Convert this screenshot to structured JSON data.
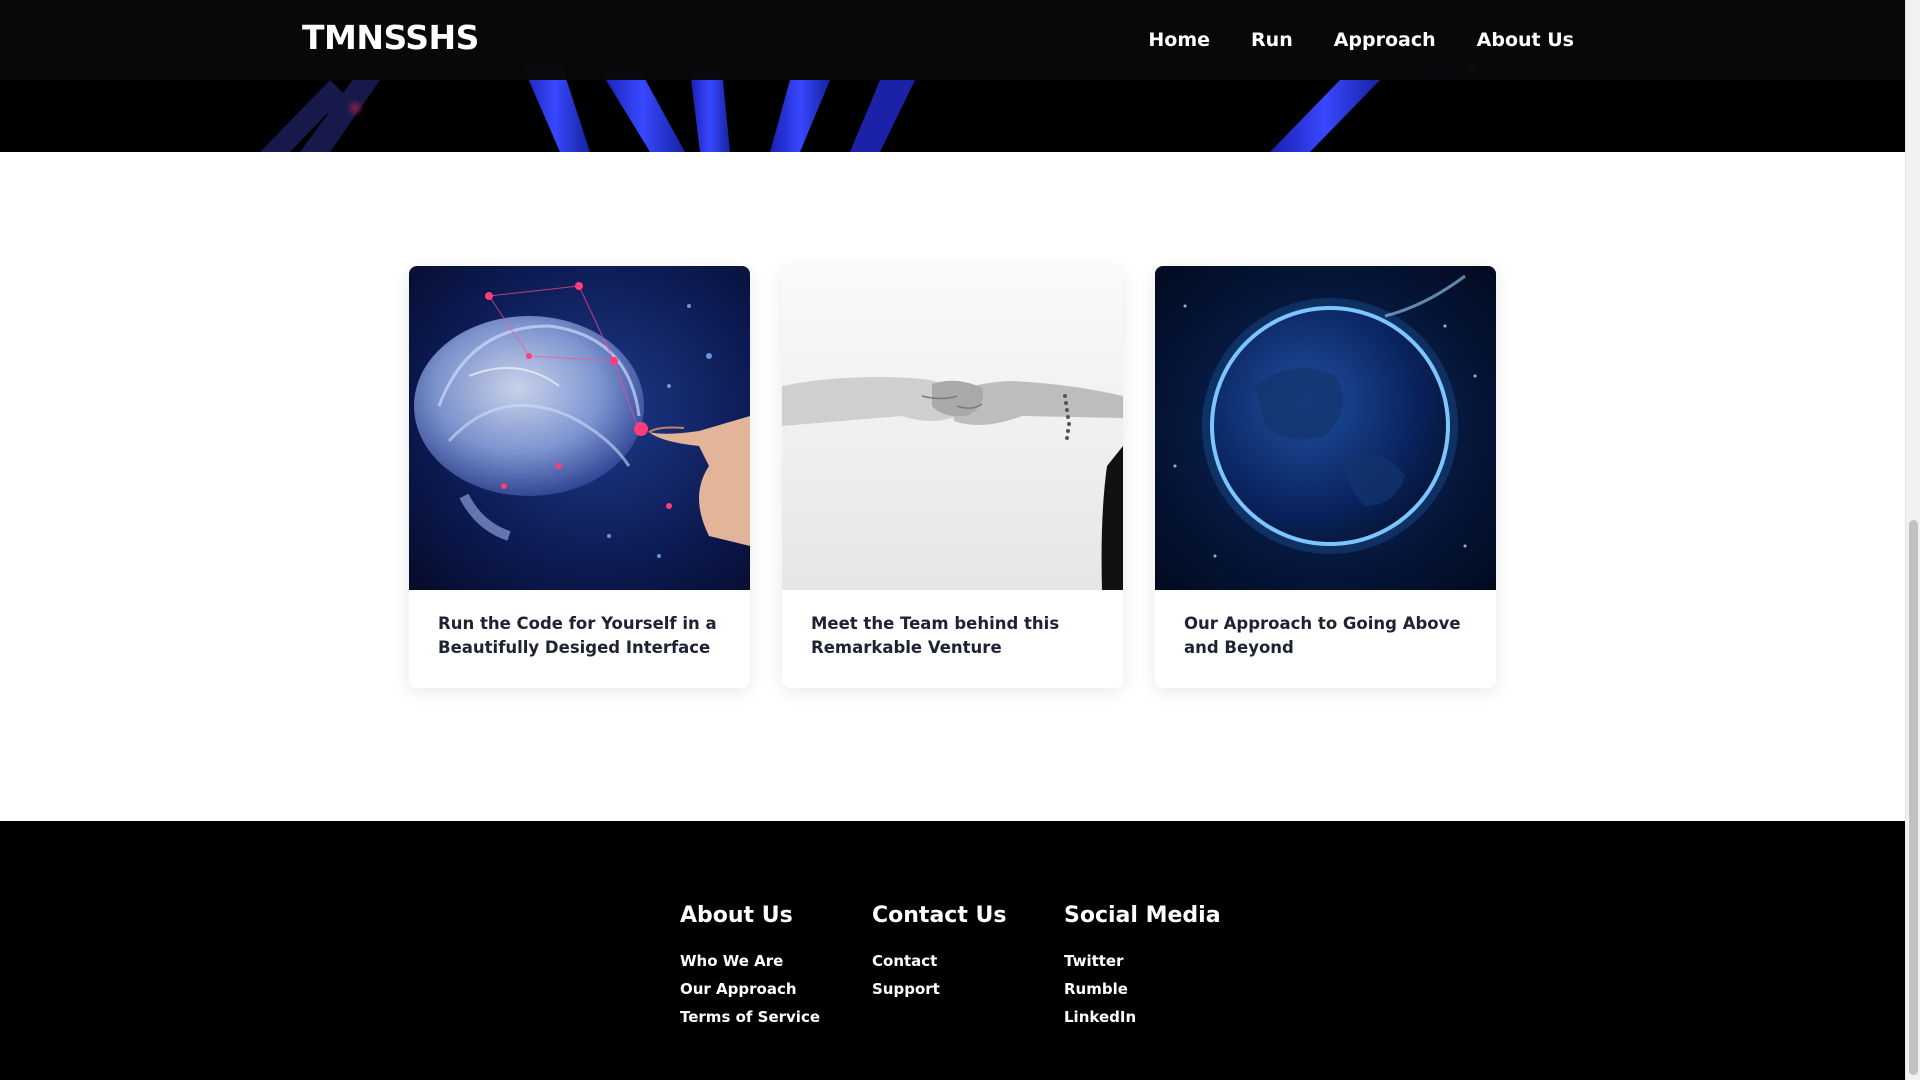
{
  "header": {
    "brand": "TMNSSHS",
    "nav": [
      {
        "label": "Home"
      },
      {
        "label": "Run"
      },
      {
        "label": "Approach"
      },
      {
        "label": "About Us"
      }
    ]
  },
  "cards": [
    {
      "title": "Run the Code for Yourself in a Beautifully Desiged Interface",
      "image": "brain-hand-image"
    },
    {
      "title": "Meet the Team behind this Remarkable Venture",
      "image": "handshake-image"
    },
    {
      "title": "Our Approach to Going Above and Beyond",
      "image": "earth-globe-image"
    }
  ],
  "footer": {
    "columns": [
      {
        "heading": "About Us",
        "links": [
          "Who We Are",
          "Our Approach",
          "Terms of Service"
        ]
      },
      {
        "heading": "Contact Us",
        "links": [
          "Contact",
          "Support"
        ]
      },
      {
        "heading": "Social Media",
        "links": [
          "Twitter",
          "Rumble",
          "LinkedIn"
        ]
      }
    ]
  },
  "colors": {
    "header_bg": "#080808",
    "footer_bg": "#000000",
    "card_title": "#1d2333",
    "accent_blue": "#2a3cff"
  }
}
